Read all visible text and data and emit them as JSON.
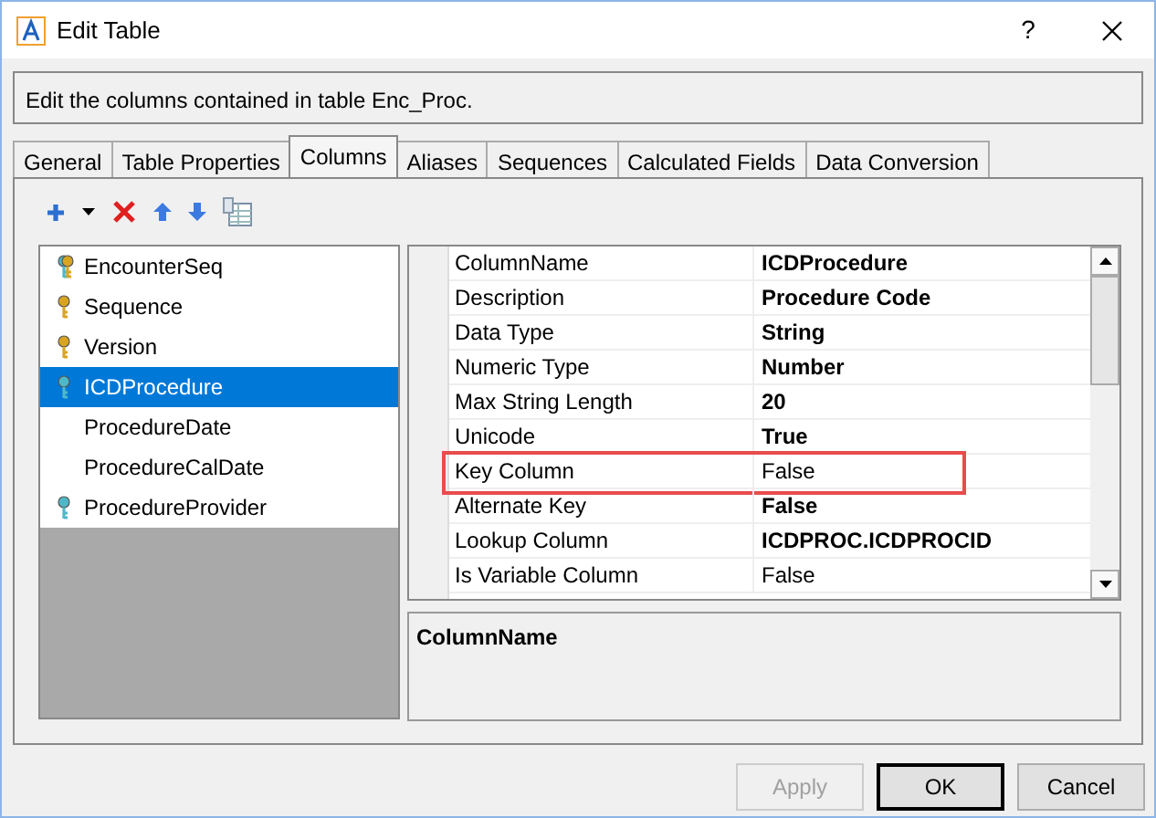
{
  "window": {
    "title": "Edit Table",
    "help": "?"
  },
  "description": "Edit the columns contained in table Enc_Proc.",
  "tabs": [
    {
      "label": "General",
      "selected": false
    },
    {
      "label": "Table Properties",
      "selected": false
    },
    {
      "label": "Columns",
      "selected": true
    },
    {
      "label": "Aliases",
      "selected": false
    },
    {
      "label": "Sequences",
      "selected": false
    },
    {
      "label": "Calculated Fields",
      "selected": false
    },
    {
      "label": "Data Conversion",
      "selected": false
    }
  ],
  "columns": [
    {
      "name": "EncounterSeq",
      "kind": "both",
      "selected": false
    },
    {
      "name": "Sequence",
      "kind": "primary",
      "selected": false
    },
    {
      "name": "Version",
      "kind": "primary",
      "selected": false
    },
    {
      "name": "ICDProcedure",
      "kind": "alternate",
      "selected": true
    },
    {
      "name": "ProcedureDate",
      "kind": "plain",
      "selected": false
    },
    {
      "name": "ProcedureCalDate",
      "kind": "plain",
      "selected": false
    },
    {
      "name": "ProcedureProvider",
      "kind": "alternate",
      "selected": false
    }
  ],
  "properties": [
    {
      "name": "ColumnName",
      "value": "ICDProcedure",
      "bold": true,
      "highlighted": false
    },
    {
      "name": "Description",
      "value": "Procedure Code",
      "bold": true,
      "highlighted": false
    },
    {
      "name": "Data Type",
      "value": "String",
      "bold": true,
      "highlighted": false
    },
    {
      "name": "Numeric Type",
      "value": "Number",
      "bold": true,
      "highlighted": false
    },
    {
      "name": "Max String Length",
      "value": "20",
      "bold": true,
      "highlighted": false
    },
    {
      "name": "Unicode",
      "value": "True",
      "bold": true,
      "highlighted": false
    },
    {
      "name": "Key Column",
      "value": "False",
      "bold": false,
      "highlighted": true
    },
    {
      "name": "Alternate Key",
      "value": "False",
      "bold": true,
      "highlighted": false
    },
    {
      "name": "Lookup Column",
      "value": "ICDPROC.ICDPROCID",
      "bold": true,
      "highlighted": false
    },
    {
      "name": "Is Variable Column",
      "value": "False",
      "bold": false,
      "highlighted": false
    }
  ],
  "property_help": {
    "title": "ColumnName"
  },
  "buttons": [
    {
      "label": "Apply",
      "disabled": true,
      "default": false
    },
    {
      "label": "OK",
      "disabled": false,
      "default": true
    },
    {
      "label": "Cancel",
      "disabled": false,
      "default": false
    }
  ]
}
